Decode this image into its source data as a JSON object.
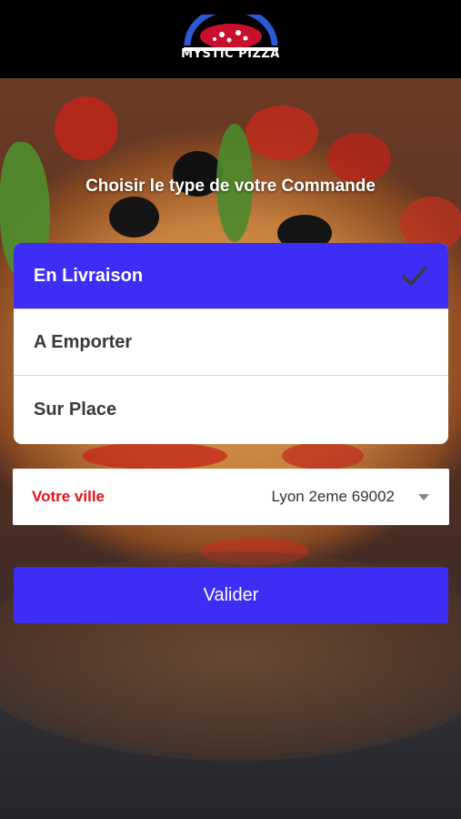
{
  "header": {
    "logo_text": "MYSTIC PIZZA"
  },
  "title": "Choisir le type de votre Commande",
  "options": [
    {
      "label": "En Livraison",
      "selected": true
    },
    {
      "label": "A Emporter",
      "selected": false
    },
    {
      "label": "Sur Place",
      "selected": false
    }
  ],
  "city": {
    "label": "Votre ville",
    "value": "Lyon 2eme 69002"
  },
  "validate_label": "Valider",
  "colors": {
    "accent": "#3d2ef5",
    "city_label": "#e8101a",
    "header": "#000000"
  },
  "icons": {
    "selected": "checkmark-icon",
    "dropdown": "caret-down-icon"
  }
}
